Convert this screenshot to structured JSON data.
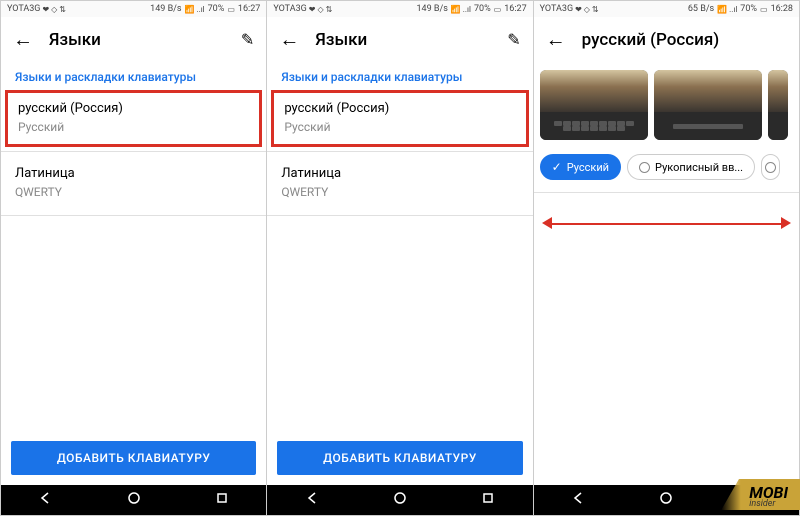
{
  "status1": {
    "carrier": "YOTA3G",
    "icons": "❤ ◇ ⇅",
    "speed": "149 B/s",
    "signal": "📶 ..ıl",
    "battery": "70%",
    "time": "16:27"
  },
  "status2": {
    "carrier": "YOTA3G",
    "icons": "❤ ◇ ⇅",
    "speed": "149 B/s",
    "signal": "📶 ..ıl",
    "battery": "70%",
    "time": "16:27"
  },
  "status3": {
    "carrier": "YOTA3G",
    "icons": "❤ ◇ ⇅",
    "speed": "65 B/s",
    "signal": "📶 ..ıl",
    "battery": "70%",
    "time": "16:28"
  },
  "header": {
    "title_langs": "Языки",
    "title_russian": "русский (Россия)"
  },
  "section": {
    "layouts": "Языки и раскладки клавиатуры"
  },
  "items": {
    "russian": {
      "primary": "русский (Россия)",
      "secondary": "Русский"
    },
    "latin": {
      "primary": "Латиница",
      "secondary": "QWERTY"
    }
  },
  "buttons": {
    "add_keyboard": "ДОБАВИТЬ КЛАВИАТУРУ"
  },
  "kb_options": {
    "opt1": "Русский",
    "opt2": "Рукописный вв..."
  },
  "watermark": {
    "main": "MOBI",
    "sub": "insider"
  }
}
